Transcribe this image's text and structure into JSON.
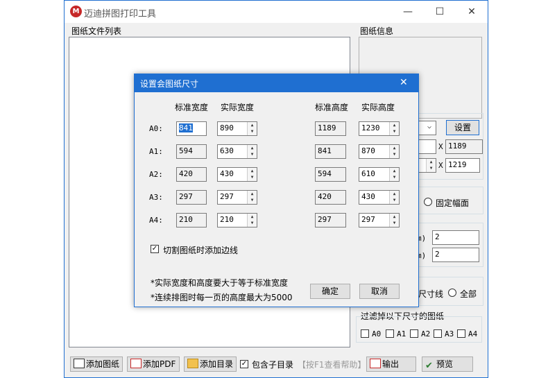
{
  "window": {
    "title": "迈迪拼图打印工具",
    "minimize": "—",
    "maximize": "☐",
    "close": "✕"
  },
  "left_panel": {
    "label": "图纸文件列表"
  },
  "right_panel": {
    "info_label": "图纸信息",
    "set_button": "设置",
    "width_value": "1189",
    "height_value": "1219",
    "x1": "X",
    "x2": "X",
    "fixed_size_label": "固定幅面",
    "val1": "2",
    "val2": "2",
    "unit1": "m)",
    "unit2": "m)",
    "cut_line_label": "尺寸线",
    "all_label": "全部",
    "filter_label": "过滤掉以下尺寸的图纸",
    "filter_items": [
      "A0",
      "A1",
      "A2",
      "A3",
      "A4"
    ]
  },
  "toolbar": {
    "add_drawing": "添加图纸",
    "add_pdf": "添加PDF",
    "add_dir": "添加目录",
    "include_subdir": "包含子目录",
    "help": "【按F1查看帮助】",
    "output": "输出",
    "preview": "预览"
  },
  "dialog": {
    "title": "设置会图纸尺寸",
    "close": "✕",
    "col_std_width": "标准宽度",
    "col_act_width": "实际宽度",
    "col_std_height": "标准高度",
    "col_act_height": "实际高度",
    "rows": [
      {
        "label": "A0:",
        "std_w": "841",
        "act_w": "890",
        "std_h": "1189",
        "act_h": "1230"
      },
      {
        "label": "A1:",
        "std_w": "594",
        "act_w": "630",
        "std_h": "841",
        "act_h": "870"
      },
      {
        "label": "A2:",
        "std_w": "420",
        "act_w": "430",
        "std_h": "594",
        "act_h": "610"
      },
      {
        "label": "A3:",
        "std_w": "297",
        "act_w": "297",
        "std_h": "420",
        "act_h": "430"
      },
      {
        "label": "A4:",
        "std_w": "210",
        "act_w": "210",
        "std_h": "297",
        "act_h": "297"
      }
    ],
    "add_border_label": "切割图纸时添加边线",
    "note1": "*实际宽度和高度要大于等于标准宽度",
    "note2": "*连续排图时每一页的高度最大为5000",
    "ok": "确定",
    "cancel": "取消"
  },
  "colors": {
    "accent": "#1f6fd1",
    "window_bg": "#f0f0f0"
  }
}
